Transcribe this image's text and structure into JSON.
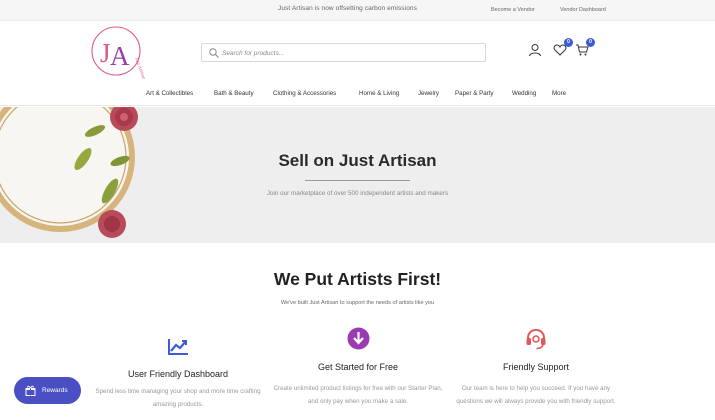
{
  "topbar": {
    "announcement": "Just Artisan is now offsetting carbon emissions",
    "links": [
      "Become a Vendor",
      "Vendor Dashboard"
    ]
  },
  "header": {
    "logo_alt": "Just Artisan",
    "search_placeholder": "Search for products...",
    "wishlist_count": "0",
    "cart_count": "0"
  },
  "nav": {
    "items": [
      "Art & Collectibles",
      "Bath & Beauty",
      "Clothing & Accessories",
      "Home & Living",
      "Jewelry",
      "Paper & Party",
      "Wedding",
      "More"
    ]
  },
  "hero": {
    "title": "Sell on Just Artisan",
    "subtitle": "Join our marketplace of over 500 independent artists and makers"
  },
  "features": {
    "title": "We Put Artists First!",
    "subtitle": "We've built Just Artisan to support the needs of artists like you",
    "items": [
      {
        "icon": "chart-icon",
        "title": "User Friendly Dashboard",
        "desc": "Spend less time managing your shop and more time crafting amazing products."
      },
      {
        "icon": "download-circle-icon",
        "title": "Get Started for Free",
        "desc": "Create unlimited product listings for free with our Starter Plan, and only pay when you make a sale."
      },
      {
        "icon": "headset-icon",
        "title": "Friendly Support",
        "desc": "Our team is here to help you succeed. If you have any questions we will always provide you with friendly support."
      }
    ]
  },
  "rewards": {
    "label": "Rewards"
  },
  "colors": {
    "brand_pink": "#e05a86",
    "accent_purple": "#9b3bb3",
    "accent_blue": "#3b5bdb",
    "accent_red": "#e05a5a",
    "rewards_bg": "#4a4fc4"
  }
}
